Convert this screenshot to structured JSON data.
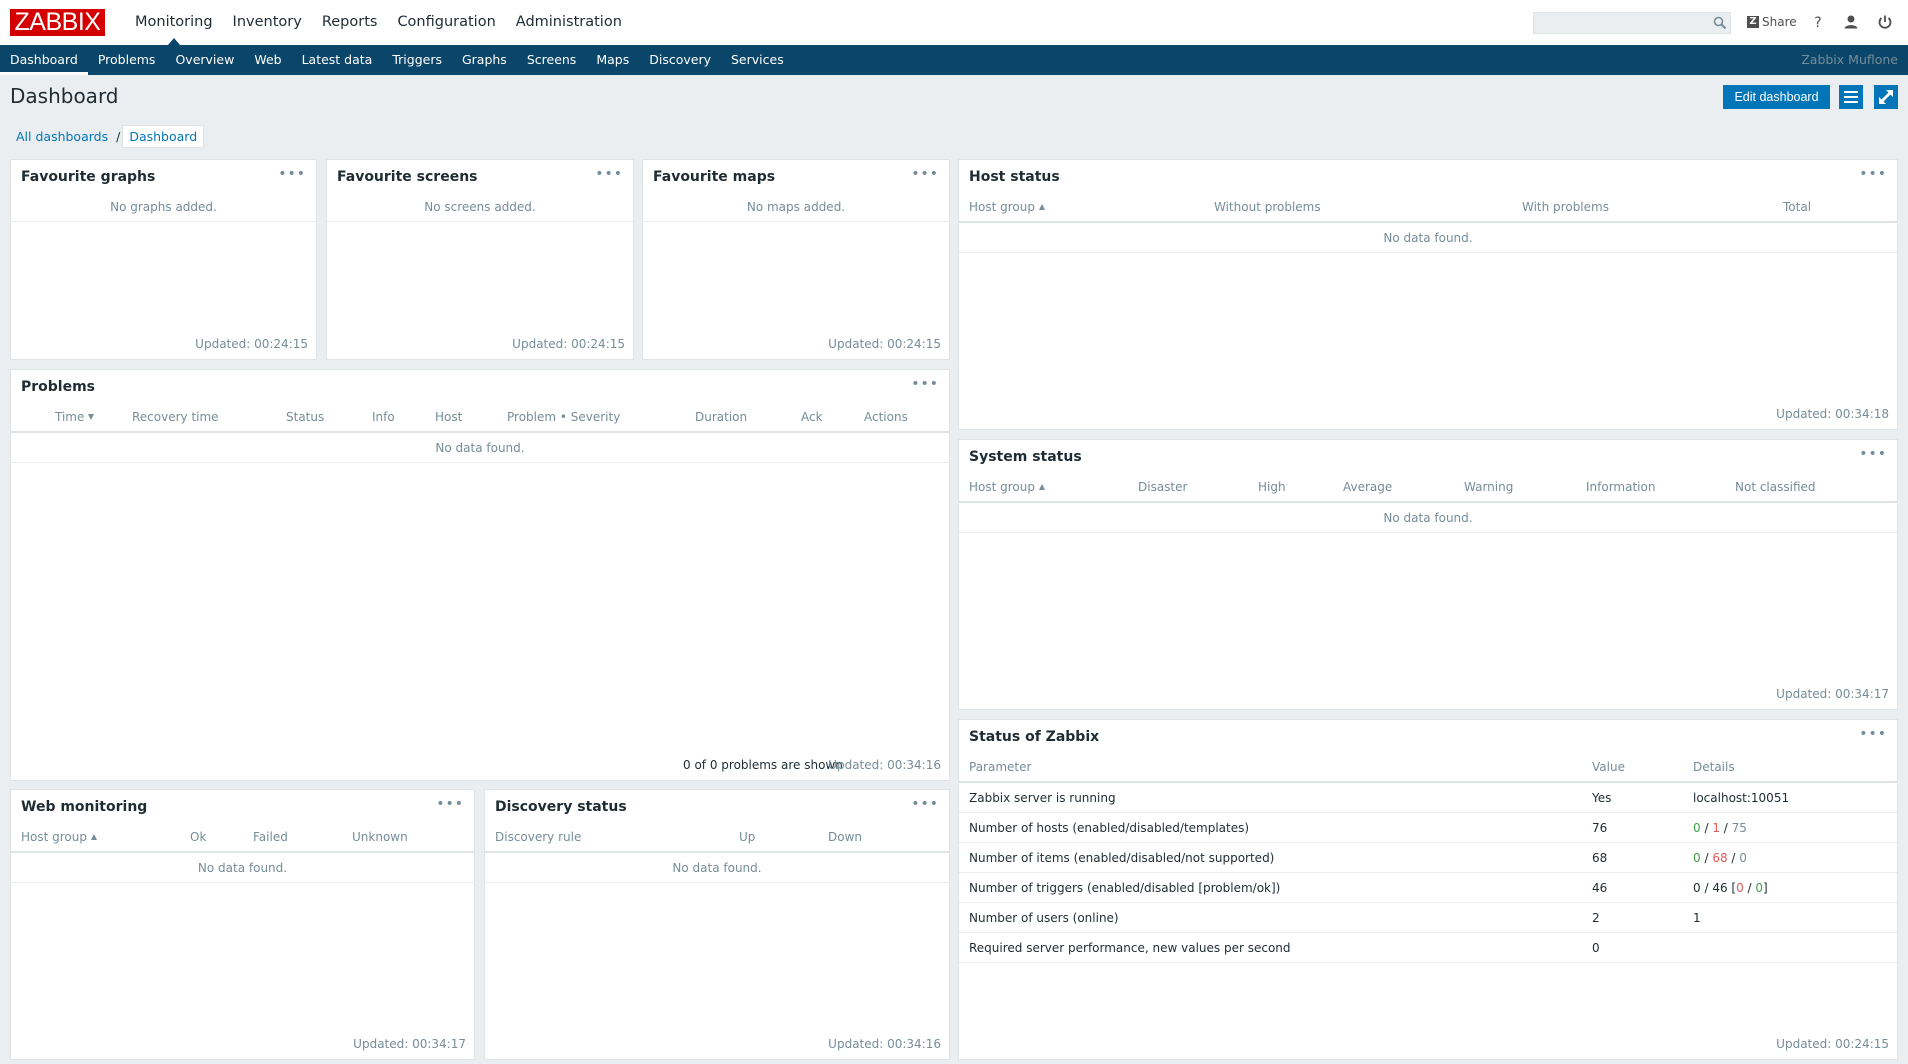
{
  "header": {
    "logo": "ZABBIX",
    "menu": [
      "Monitoring",
      "Inventory",
      "Reports",
      "Configuration",
      "Administration"
    ],
    "share_label": "Share",
    "share_mark": "Z"
  },
  "submenu": {
    "items": [
      "Dashboard",
      "Problems",
      "Overview",
      "Web",
      "Latest data",
      "Triggers",
      "Graphs",
      "Screens",
      "Maps",
      "Discovery",
      "Services"
    ],
    "server_name": "Zabbix Muflone"
  },
  "page": {
    "title": "Dashboard",
    "edit_label": "Edit dashboard",
    "breadcrumb": {
      "root": "All dashboards",
      "separator": "/",
      "current": "Dashboard"
    }
  },
  "widgets": {
    "fav_graphs": {
      "title": "Favourite graphs",
      "empty": "No graphs added.",
      "updated": "Updated: 00:24:15"
    },
    "fav_screens": {
      "title": "Favourite screens",
      "empty": "No screens added.",
      "updated": "Updated: 00:24:15"
    },
    "fav_maps": {
      "title": "Favourite maps",
      "empty": "No maps added.",
      "updated": "Updated: 00:24:15"
    },
    "host_status": {
      "title": "Host status",
      "columns": [
        "Host group",
        "Without problems",
        "With problems",
        "Total"
      ],
      "empty": "No data found.",
      "updated": "Updated: 00:34:18"
    },
    "problems": {
      "title": "Problems",
      "columns": [
        "Time",
        "Recovery time",
        "Status",
        "Info",
        "Host",
        "Problem • Severity",
        "Duration",
        "Ack",
        "Actions"
      ],
      "empty": "No data found.",
      "shown": "0 of 0 problems are shown",
      "updated": "Updated: 00:34:16"
    },
    "system_status": {
      "title": "System status",
      "columns": [
        "Host group",
        "Disaster",
        "High",
        "Average",
        "Warning",
        "Information",
        "Not classified"
      ],
      "empty": "No data found.",
      "updated": "Updated: 00:34:17"
    },
    "web_monitoring": {
      "title": "Web monitoring",
      "columns": [
        "Host group",
        "Ok",
        "Failed",
        "Unknown"
      ],
      "empty": "No data found.",
      "updated": "Updated: 00:34:17"
    },
    "discovery_status": {
      "title": "Discovery status",
      "columns": [
        "Discovery rule",
        "Up",
        "Down"
      ],
      "empty": "No data found.",
      "updated": "Updated: 00:34:16"
    },
    "zabbix_status": {
      "title": "Status of Zabbix",
      "columns": [
        "Parameter",
        "Value",
        "Details"
      ],
      "rows": [
        {
          "parameter": "Zabbix server is running",
          "value": "Yes",
          "details": "localhost:10051"
        },
        {
          "parameter": "Number of hosts (enabled/disabled/templates)",
          "value": "76",
          "d1": "0",
          "d2": "1",
          "d3": "75"
        },
        {
          "parameter": "Number of items (enabled/disabled/not supported)",
          "value": "68",
          "d1": "0",
          "d2": "68",
          "d3": "0"
        },
        {
          "parameter": "Number of triggers (enabled/disabled [problem/ok])",
          "value": "46",
          "d1": "0",
          "d2": "46",
          "d3": "0",
          "d4": "0"
        },
        {
          "parameter": "Number of users (online)",
          "value": "2",
          "details": "1"
        },
        {
          "parameter": "Required server performance, new values per second",
          "value": "0",
          "details": ""
        }
      ],
      "updated": "Updated: 00:24:15"
    }
  },
  "colors": {
    "brand": "#d40000",
    "nav": "#0a466a",
    "accent": "#0275b8",
    "ok": "#429e47",
    "problem": "#e45959"
  }
}
